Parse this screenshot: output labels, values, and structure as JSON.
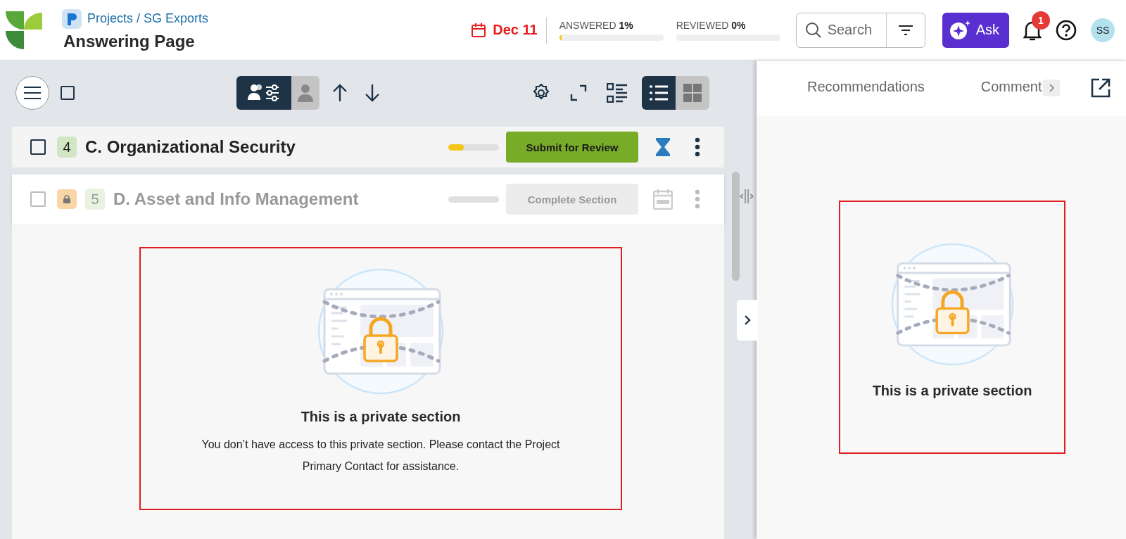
{
  "header": {
    "breadcrumb": "Projects / SG Exports",
    "title": "Answering Page",
    "due_date": "Dec 11",
    "progress": [
      {
        "label": "ANSWERED **1%**",
        "level": 0.02
      },
      {
        "label": "REVIEWED **0%**",
        "level": 0
      }
    ],
    "search": {
      "placeholder": "Search"
    },
    "ask_label": "Ask",
    "notification_count": "1",
    "avatar_initials": "SS"
  },
  "toolbar": {
    "select_all_checked": false,
    "assignee_views": [
      {
        "kind": "team",
        "selected": true
      },
      {
        "kind": "person",
        "selected": false
      }
    ],
    "layouts": [
      {
        "kind": "list",
        "selected": true
      },
      {
        "kind": "grid",
        "selected": false
      }
    ]
  },
  "sections": [
    {
      "checked": false,
      "number": "4",
      "title": "C. Organizational Security",
      "locked": false,
      "level": 0.3,
      "action": {
        "label": "Submit for Review",
        "disabled": false
      }
    },
    {
      "checked": false,
      "number": "5",
      "title": "D. Asset and Info Management",
      "locked": true,
      "level": 0,
      "action": {
        "label": "Complete Section",
        "disabled": true
      }
    }
  ],
  "private_section": {
    "title": "This is a private section",
    "message": "You don’t have access to this private section. Please contact the Project Primary Contact for assistance."
  },
  "side_panel": {
    "tabs": [
      {
        "label": "Recommendations",
        "selected": false
      },
      {
        "label": "Comment",
        "selected": false
      }
    ],
    "private_section": {
      "title": "This is a private section"
    }
  }
}
